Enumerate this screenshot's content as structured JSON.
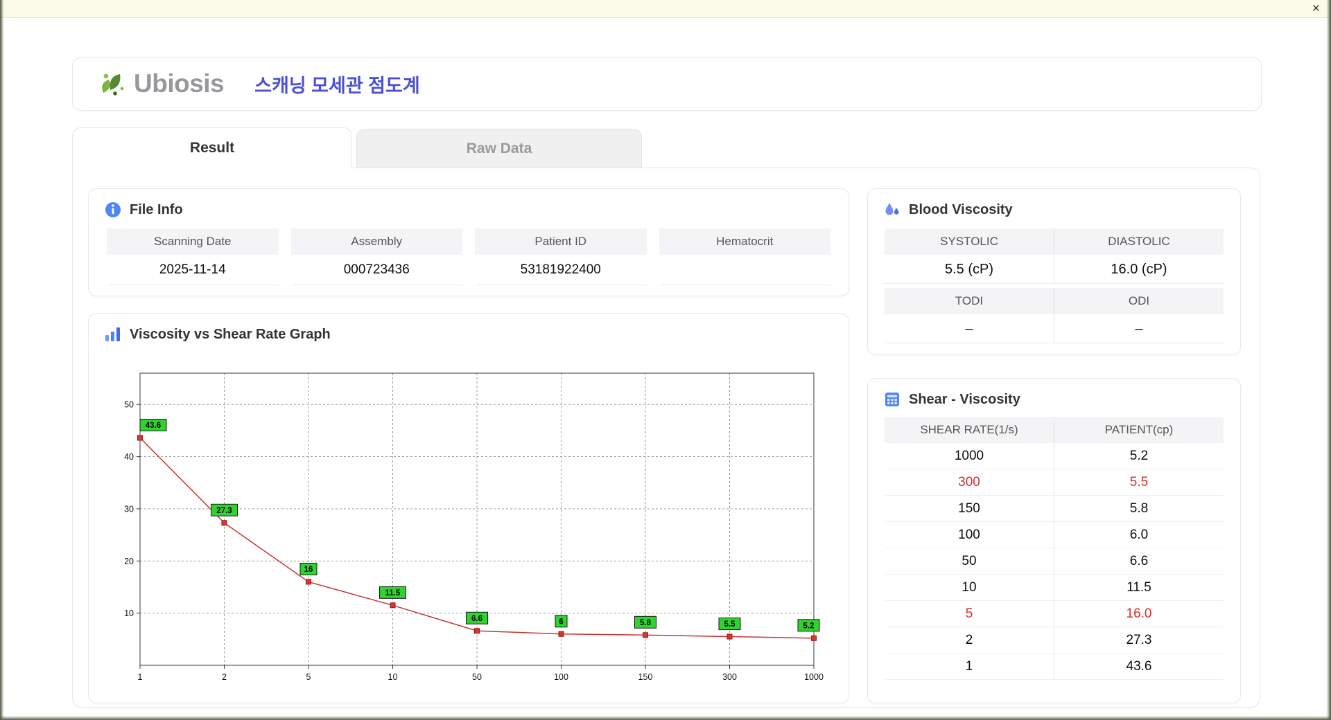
{
  "window": {
    "close_label": "×"
  },
  "header": {
    "logo_text": "Ubiosis",
    "title": "스캐닝 모세관 점도계"
  },
  "tabs": [
    {
      "label": "Result",
      "active": true
    },
    {
      "label": "Raw Data",
      "active": false
    }
  ],
  "file_info": {
    "title": "File Info",
    "fields": [
      {
        "label": "Scanning Date",
        "value": "2025-11-14"
      },
      {
        "label": "Assembly",
        "value": "000723436"
      },
      {
        "label": "Patient ID",
        "value": "53181922400"
      },
      {
        "label": "Hematocrit",
        "value": ""
      }
    ]
  },
  "blood_viscosity": {
    "title": "Blood Viscosity",
    "rows": [
      {
        "label_left": "SYSTOLIC",
        "label_right": "DIASTOLIC",
        "value_left": "5.5 (cP)",
        "value_right": "16.0 (cP)"
      },
      {
        "label_left": "TODI",
        "label_right": "ODI",
        "value_left": "–",
        "value_right": "–"
      }
    ]
  },
  "graph": {
    "title": "Viscosity vs Shear Rate Graph"
  },
  "chart_data": {
    "type": "line",
    "title": "Viscosity vs Shear Rate Graph",
    "x_categories": [
      "1",
      "2",
      "5",
      "10",
      "50",
      "100",
      "150",
      "300",
      "1000"
    ],
    "values": [
      43.6,
      27.3,
      16,
      11.5,
      6.6,
      6,
      5.8,
      5.5,
      5.2
    ],
    "point_labels": [
      "43.6",
      "27.3",
      "16",
      "11.5",
      "6.6",
      "6",
      "5.8",
      "5.5",
      "5.2"
    ],
    "xlabel": "",
    "ylabel": "",
    "ylim": [
      0,
      56
    ],
    "yticks": [
      10,
      20,
      30,
      40,
      50
    ],
    "grid": "dashed",
    "line_color": "#c43636",
    "marker_color": "#e23333",
    "marker_border": "#8b1a1a",
    "label_bg": "#2fd32f",
    "label_border": "#1a1a1a"
  },
  "shear_table": {
    "title": "Shear - Viscosity",
    "columns": [
      "SHEAR RATE(1/s)",
      "PATIENT(cp)"
    ],
    "rows": [
      {
        "shear": "1000",
        "patient": "5.2",
        "highlight": false
      },
      {
        "shear": "300",
        "patient": "5.5",
        "highlight": true
      },
      {
        "shear": "150",
        "patient": "5.8",
        "highlight": false
      },
      {
        "shear": "100",
        "patient": "6.0",
        "highlight": false
      },
      {
        "shear": "50",
        "patient": "6.6",
        "highlight": false
      },
      {
        "shear": "10",
        "patient": "11.5",
        "highlight": false
      },
      {
        "shear": "5",
        "patient": "16.0",
        "highlight": true
      },
      {
        "shear": "2",
        "patient": "27.3",
        "highlight": false
      },
      {
        "shear": "1",
        "patient": "43.6",
        "highlight": false
      }
    ]
  }
}
